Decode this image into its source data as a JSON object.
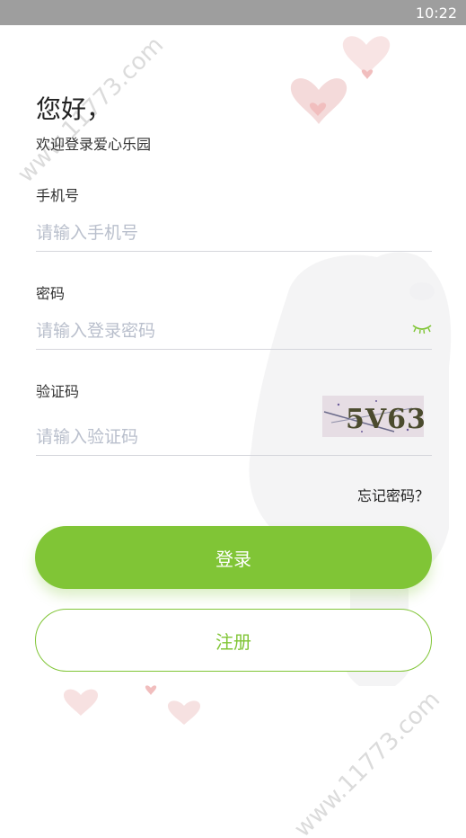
{
  "status_bar": {
    "time": "10:22"
  },
  "header": {
    "greeting": "您好，",
    "welcome": "欢迎登录爱心乐园"
  },
  "form": {
    "phone": {
      "label": "手机号",
      "placeholder": "请输入手机号",
      "value": ""
    },
    "password": {
      "label": "密码",
      "placeholder": "请输入登录密码",
      "value": ""
    },
    "captcha": {
      "label": "验证码",
      "placeholder": "请输入验证码",
      "value": "",
      "image_text": "5V63"
    }
  },
  "links": {
    "forgot_password": "忘记密码？"
  },
  "buttons": {
    "login": "登录",
    "register": "注册"
  },
  "colors": {
    "accent": "#80c536",
    "placeholder": "#b9bfcc",
    "divider": "#d5d6dc"
  },
  "watermark": {
    "text": "www.11773.com"
  }
}
